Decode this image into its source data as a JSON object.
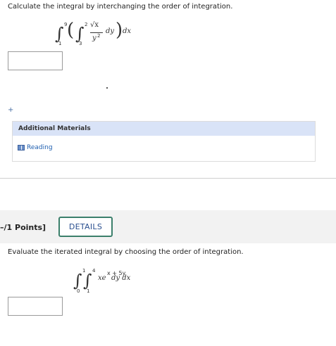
{
  "question1": {
    "prompt": "Calculate the integral by interchanging the order of integration.",
    "outer_upper": "9",
    "outer_lower": "1",
    "inner_upper": "2",
    "inner_lower": "3",
    "integrand_num": "√x",
    "integrand_den": "y",
    "integrand_den_exp": "2",
    "inner_diff": "dy",
    "outer_diff": "dx"
  },
  "plus_icon": "+",
  "additional_materials": {
    "header": "Additional Materials",
    "reading_label": "Reading"
  },
  "question2": {
    "points_label": "–/1 Points]",
    "details_label": "DETAILS",
    "prompt": "Evaluate the iterated integral by choosing the order of integration.",
    "outer_upper": "1",
    "outer_lower": "0",
    "inner_upper": "4",
    "inner_lower": "1",
    "integrand": "xe",
    "exponent": "x + 5y",
    "differentials": "dy dx"
  },
  "colors": {
    "header_band": "#d9e3f7",
    "link": "#1f5fb0",
    "button_border": "#3b7f6b"
  }
}
